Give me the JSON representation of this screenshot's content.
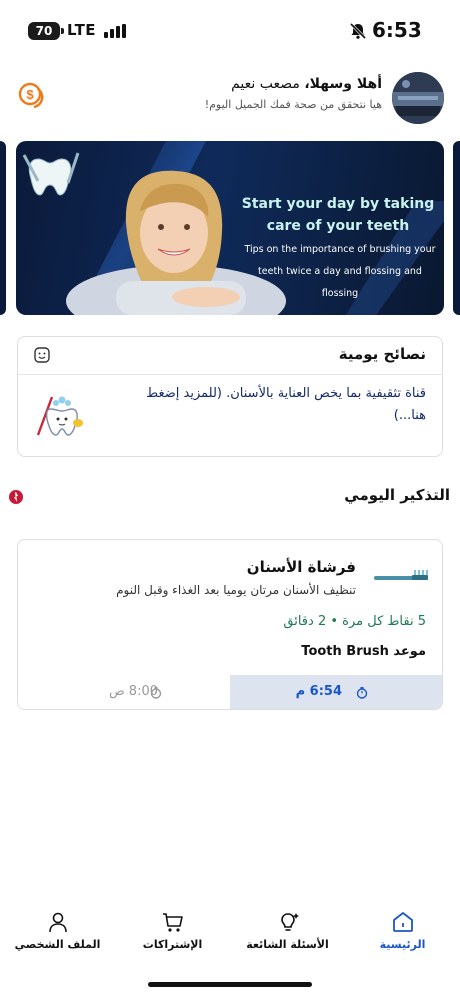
{
  "status_bar": {
    "battery": "70",
    "network": "LTE",
    "time": "6:53"
  },
  "header": {
    "greeting_bold": "أهلا وسهلا،",
    "user_name": " مصعب نعيم",
    "subtitle": "هيا نتحقق من صحة فمك الجميل اليوم!"
  },
  "banner": {
    "title": "Start your day by taking care of your teeth",
    "subtitle": "Tips on the importance of brushing your teeth twice a day and flossing and flossing"
  },
  "daily_tips": {
    "title": "نصائح يومية",
    "text": "قناة تثقيفية بما يخص العناية بالأسنان. (للمزيد إضغط هنا...)"
  },
  "daily_reminder": {
    "title": "التذكير اليومي",
    "card": {
      "name": "فرشاة الأسنان",
      "description": "تنظيف الأسنان مرتان يوميا بعد الغذاء وقبل النوم",
      "points": "5 نقاط كل مرة • 2 دقائق",
      "appointment": "موعد Tooth Brush",
      "time_active": "6:54 م",
      "time_other": "8:00 ص"
    }
  },
  "bottom_nav": {
    "items": [
      {
        "label": "الرئيسية",
        "icon": "home-icon",
        "active": true
      },
      {
        "label": "الأسئلة الشائعة",
        "icon": "lightbulb-icon",
        "active": false
      },
      {
        "label": "الإشتراكات",
        "icon": "cart-icon",
        "active": false
      },
      {
        "label": "الملف الشخصي",
        "icon": "user-icon",
        "active": false
      }
    ]
  },
  "colors": {
    "primary": "#1a56c9",
    "accent_orange": "#f07a1a",
    "green_text": "#1d7a55",
    "alert_red": "#c81935",
    "time_highlight": "#dde4f0"
  }
}
